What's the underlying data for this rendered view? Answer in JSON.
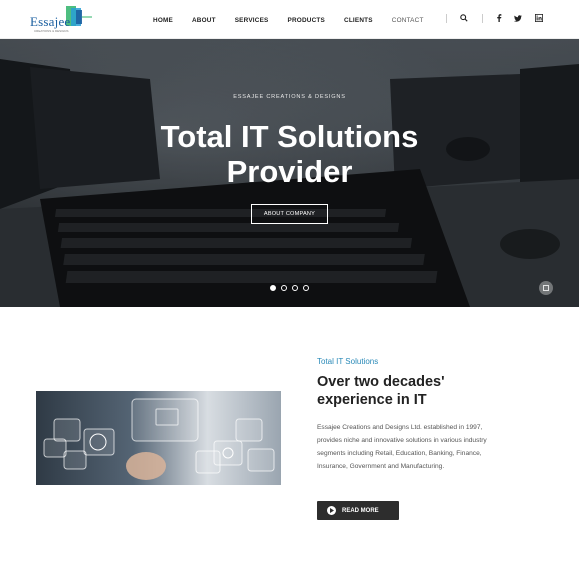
{
  "header": {
    "logo_text": "Essajee",
    "logo_tagline": "CREATIONS & DESIGNS",
    "nav": [
      "HOME",
      "ABOUT",
      "SERVICES",
      "PRODUCTS",
      "CLIENTS",
      "CONTACT"
    ],
    "icons": [
      "search-icon",
      "facebook-icon",
      "twitter-icon",
      "linkedin-icon"
    ]
  },
  "hero": {
    "eyebrow": "ESSAJEE CREATIONS & DESIGNS",
    "title_line1": "Total IT Solutions",
    "title_line2": "Provider",
    "button": "ABOUT COMPANY",
    "slides": 4,
    "active_slide": 1
  },
  "about": {
    "kicker": "Total IT Solutions",
    "heading": "Over two decades' experience in IT",
    "body": "Essajee Creations and Designs Ltd. established in 1997, provides niche and innovative solutions in various industry segments including Retail, Education, Banking, Finance, Insurance, Government and Manufacturing.",
    "button": "READ MORE"
  },
  "colors": {
    "accent": "#2a8ab8",
    "logo_blue": "#1a5fa0",
    "logo_green": "#2fb36a",
    "dark_button": "#2d2d2d"
  }
}
